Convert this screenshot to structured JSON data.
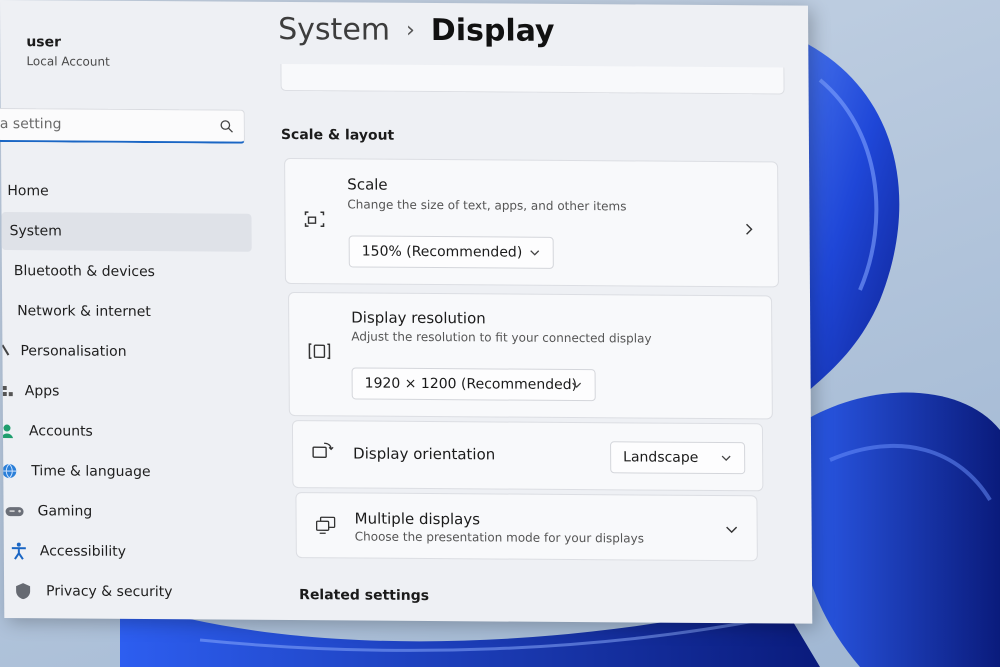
{
  "user": {
    "name": "user",
    "account": "Local Account"
  },
  "search": {
    "placeholder": "a setting"
  },
  "sidebar": {
    "items": [
      {
        "label": "Home",
        "icon": "home-icon",
        "active": false
      },
      {
        "label": "System",
        "icon": "system-icon",
        "active": true
      },
      {
        "label": "Bluetooth & devices",
        "icon": "bluetooth-icon",
        "active": false
      },
      {
        "label": "Network & internet",
        "icon": "network-icon",
        "active": false
      },
      {
        "label": "Personalisation",
        "icon": "brush-icon",
        "active": false
      },
      {
        "label": "Apps",
        "icon": "apps-icon",
        "active": false
      },
      {
        "label": "Accounts",
        "icon": "accounts-icon",
        "active": false
      },
      {
        "label": "Time & language",
        "icon": "globe-icon",
        "active": false
      },
      {
        "label": "Gaming",
        "icon": "gamepad-icon",
        "active": false
      },
      {
        "label": "Accessibility",
        "icon": "accessibility-icon",
        "active": false
      },
      {
        "label": "Privacy & security",
        "icon": "shield-icon",
        "active": false
      }
    ]
  },
  "breadcrumb": {
    "parent": "System",
    "separator": "›",
    "current": "Display"
  },
  "scale_layout": {
    "title": "Scale & layout",
    "scale": {
      "title": "Scale",
      "description": "Change the size of text, apps, and other items",
      "value": "150% (Recommended)"
    },
    "resolution": {
      "title": "Display resolution",
      "description": "Adjust the resolution to fit your connected display",
      "value": "1920 × 1200 (Recommended)"
    },
    "orientation": {
      "title": "Display orientation",
      "value": "Landscape"
    },
    "multiple": {
      "title": "Multiple displays",
      "description": "Choose the presentation mode for your displays"
    }
  },
  "related": {
    "title": "Related settings"
  },
  "colors": {
    "accent": "#1a66c4",
    "window_bg": "#eef0f4",
    "card_bg": "#f8f9fb",
    "wallpaper_blue": "#1f47d8"
  }
}
